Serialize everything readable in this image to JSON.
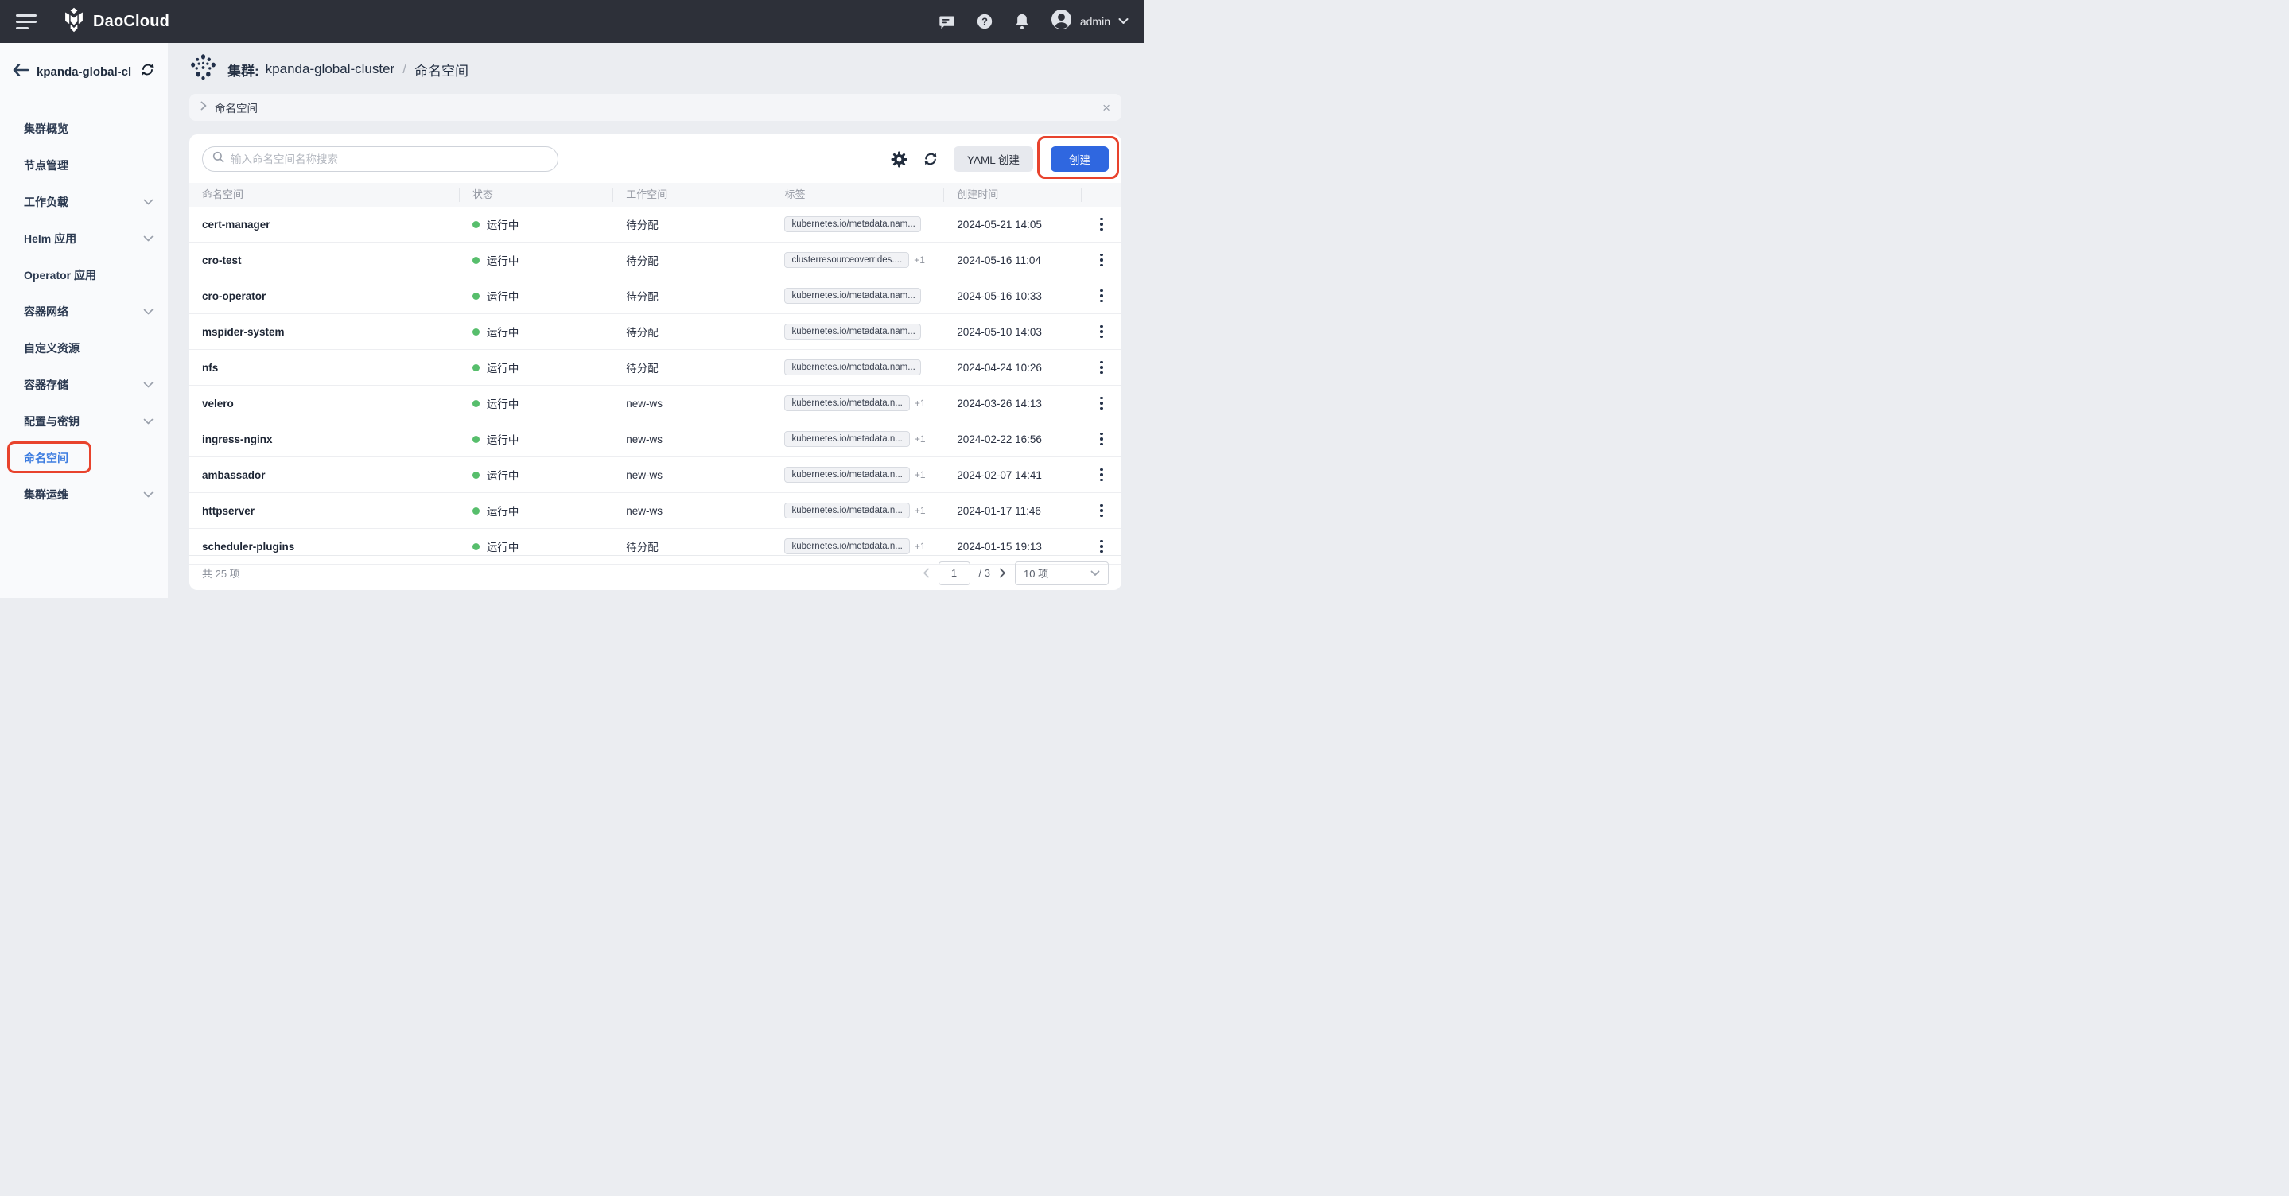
{
  "topbar": {
    "brand": "DaoCloud",
    "user": "admin"
  },
  "sidebar": {
    "cluster_name": "kpanda-global-cl...",
    "items": [
      {
        "label": "集群概览",
        "expandable": false,
        "active": false,
        "annotated": false
      },
      {
        "label": "节点管理",
        "expandable": false,
        "active": false,
        "annotated": false
      },
      {
        "label": "工作负载",
        "expandable": true,
        "active": false,
        "annotated": false
      },
      {
        "label": "Helm 应用",
        "expandable": true,
        "active": false,
        "annotated": false
      },
      {
        "label": "Operator 应用",
        "expandable": false,
        "active": false,
        "annotated": false
      },
      {
        "label": "容器网络",
        "expandable": true,
        "active": false,
        "annotated": false
      },
      {
        "label": "自定义资源",
        "expandable": false,
        "active": false,
        "annotated": false
      },
      {
        "label": "容器存储",
        "expandable": true,
        "active": false,
        "annotated": false
      },
      {
        "label": "配置与密钥",
        "expandable": true,
        "active": false,
        "annotated": false
      },
      {
        "label": "命名空间",
        "expandable": false,
        "active": true,
        "annotated": true
      },
      {
        "label": "集群运维",
        "expandable": true,
        "active": false,
        "annotated": false
      }
    ]
  },
  "header": {
    "cluster_label": "集群:",
    "cluster_name": "kpanda-global-cluster",
    "separator": "/",
    "page": "命名空间"
  },
  "tabbar": {
    "tab": "命名空间",
    "close": "×"
  },
  "toolbar": {
    "search_placeholder": "输入命名空间名称搜索",
    "yaml_button": "YAML 创建",
    "create_button": "创建"
  },
  "table": {
    "columns": [
      "命名空间",
      "状态",
      "工作空间",
      "标签",
      "创建时间"
    ],
    "rows": [
      {
        "name": "cert-manager",
        "status": "运行中",
        "workspace": "待分配",
        "label": "kubernetes.io/metadata.nam...",
        "extra": "",
        "created": "2024-05-21 14:05"
      },
      {
        "name": "cro-test",
        "status": "运行中",
        "workspace": "待分配",
        "label": "clusterresourceoverrides....",
        "extra": "+1",
        "created": "2024-05-16 11:04"
      },
      {
        "name": "cro-operator",
        "status": "运行中",
        "workspace": "待分配",
        "label": "kubernetes.io/metadata.nam...",
        "extra": "",
        "created": "2024-05-16 10:33"
      },
      {
        "name": "mspider-system",
        "status": "运行中",
        "workspace": "待分配",
        "label": "kubernetes.io/metadata.nam...",
        "extra": "",
        "created": "2024-05-10 14:03"
      },
      {
        "name": "nfs",
        "status": "运行中",
        "workspace": "待分配",
        "label": "kubernetes.io/metadata.nam...",
        "extra": "",
        "created": "2024-04-24 10:26"
      },
      {
        "name": "velero",
        "status": "运行中",
        "workspace": "new-ws",
        "label": "kubernetes.io/metadata.n...",
        "extra": "+1",
        "created": "2024-03-26 14:13"
      },
      {
        "name": "ingress-nginx",
        "status": "运行中",
        "workspace": "new-ws",
        "label": "kubernetes.io/metadata.n...",
        "extra": "+1",
        "created": "2024-02-22 16:56"
      },
      {
        "name": "ambassador",
        "status": "运行中",
        "workspace": "new-ws",
        "label": "kubernetes.io/metadata.n...",
        "extra": "+1",
        "created": "2024-02-07 14:41"
      },
      {
        "name": "httpserver",
        "status": "运行中",
        "workspace": "new-ws",
        "label": "kubernetes.io/metadata.n...",
        "extra": "+1",
        "created": "2024-01-17 11:46"
      },
      {
        "name": "scheduler-plugins",
        "status": "运行中",
        "workspace": "待分配",
        "label": "kubernetes.io/metadata.n...",
        "extra": "+1",
        "created": "2024-01-15 19:13"
      }
    ]
  },
  "footer": {
    "total": "共 25 项",
    "page": "1",
    "page_total": "/ 3",
    "page_size": "10 项"
  },
  "colors": {
    "accent_blue": "#2f67e0",
    "status_green": "#57be6c",
    "annotation_red": "#e8432d",
    "topbar_bg": "#2d3039"
  }
}
